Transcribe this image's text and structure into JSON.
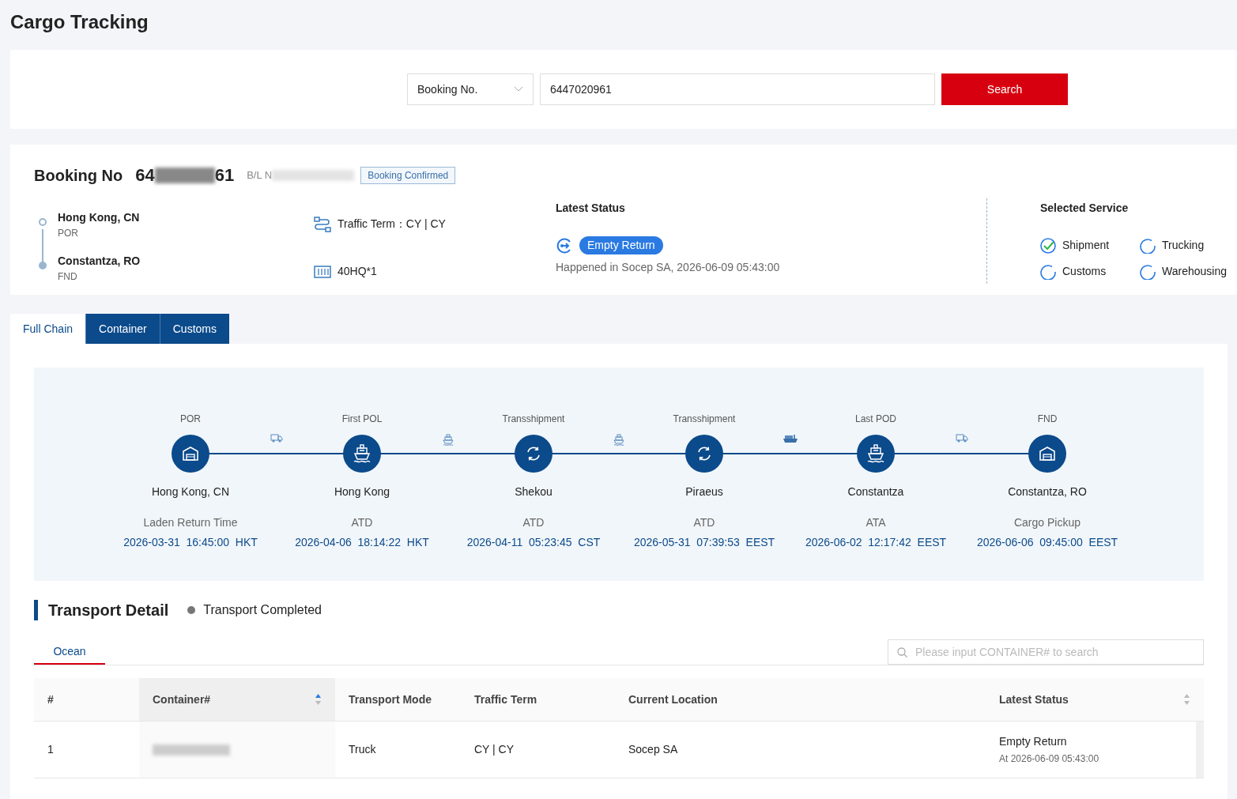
{
  "page_title": "Cargo Tracking",
  "search": {
    "type_select": "Booking No.",
    "value": "6447020961",
    "button": "Search"
  },
  "booking": {
    "label": "Booking No",
    "number_start": "64",
    "number_end": "61",
    "bl_label": "B/L N",
    "status_badge": "Booking Confirmed",
    "route": [
      {
        "place": "Hong Kong, CN",
        "code": "POR",
        "reached": false
      },
      {
        "place": "Constantza, RO",
        "code": "FND",
        "reached": true
      }
    ],
    "traffic_term": "Traffic Term：CY | CY",
    "equipment": "40HQ*1",
    "latest_status": {
      "heading": "Latest Status",
      "status": "Empty Return",
      "detail": "Happened in Socep SA, 2026-06-09 05:43:00"
    },
    "selected_service": {
      "heading": "Selected Service",
      "items": [
        {
          "label": "Shipment",
          "checked": true
        },
        {
          "label": "Trucking",
          "checked": false
        },
        {
          "label": "Customs",
          "checked": false
        },
        {
          "label": "Warehousing",
          "checked": false
        }
      ]
    }
  },
  "tabs": [
    {
      "label": "Full Chain",
      "selected": true
    },
    {
      "label": "Container",
      "selected": false
    },
    {
      "label": "Customs",
      "selected": false
    }
  ],
  "chain": {
    "stops": [
      {
        "label": "POR",
        "kind": "warehouse",
        "place": "Hong Kong, CN",
        "event": "Laden Return Time",
        "time": "2026-03-31  16:45:00  HKT"
      },
      {
        "label": "First POL",
        "kind": "ship",
        "place": "Hong Kong",
        "event": "ATD",
        "time": "2026-04-06  18:14:22  HKT"
      },
      {
        "label": "Transshipment",
        "kind": "transship",
        "place": "Shekou",
        "event": "ATD",
        "time": "2026-04-11  05:23:45  CST"
      },
      {
        "label": "Transshipment",
        "kind": "transship",
        "place": "Piraeus",
        "event": "ATD",
        "time": "2026-05-31  07:39:53  EEST"
      },
      {
        "label": "Last POD",
        "kind": "ship",
        "place": "Constantza",
        "event": "ATA",
        "time": "2026-06-02  12:17:42  EEST"
      },
      {
        "label": "FND",
        "kind": "warehouse",
        "place": "Constantza, RO",
        "event": "Cargo Pickup",
        "time": "2026-06-06  09:45:00  EEST"
      }
    ],
    "legs": [
      {
        "kind": "truck"
      },
      {
        "kind": "ship"
      },
      {
        "kind": "ship"
      },
      {
        "kind": "barge"
      },
      {
        "kind": "truck"
      }
    ]
  },
  "transport_detail": {
    "title": "Transport Detail",
    "status": "Transport Completed",
    "subtabs": [
      {
        "label": "Ocean",
        "selected": true
      }
    ],
    "search_placeholder": "Please input CONTAINER# to search",
    "columns": [
      {
        "label": "#",
        "sortable": false,
        "sorted": false
      },
      {
        "label": "Container#",
        "sortable": true,
        "sorted": true
      },
      {
        "label": "Transport Mode",
        "sortable": false,
        "sorted": false
      },
      {
        "label": "Traffic Term",
        "sortable": false,
        "sorted": false
      },
      {
        "label": "Current Location",
        "sortable": false,
        "sorted": false
      },
      {
        "label": "Latest Status",
        "sortable": true,
        "sorted": false
      }
    ],
    "rows": [
      {
        "index": "1",
        "mode": "Truck",
        "term": "CY | CY",
        "location": "Socep SA",
        "status": "Empty Return",
        "status_time": "At 2026-06-09 05:43:00"
      }
    ]
  }
}
